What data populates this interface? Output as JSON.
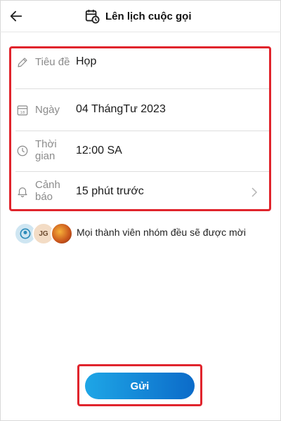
{
  "header": {
    "title": "Lên lịch cuộc gọi"
  },
  "form": {
    "title_row": {
      "label": "Tiêu đề",
      "value": "Họp"
    },
    "date_row": {
      "label": "Ngày",
      "value": "04 ThángTư 2023"
    },
    "time_row": {
      "label_line1": "Thời",
      "label_line2": "gian",
      "value": "12:00 SA"
    },
    "alert_row": {
      "label_line1": "Cảnh",
      "label_line2": "báo",
      "value": "15 phút trước"
    }
  },
  "participants": {
    "avatar_initials": "JG",
    "invite_text": "Mọi thành viên nhóm đều sẽ được mời"
  },
  "send_button": {
    "label": "Gửi"
  },
  "colors": {
    "highlight": "#e0242c",
    "button_start": "#1ea6e6",
    "button_end": "#0c6bc9",
    "muted_text": "#8b8b8b"
  },
  "icons": {
    "back": "arrow-left-icon",
    "calendar_clock": "calendar-clock-icon",
    "pencil": "pencil-icon",
    "calendar": "calendar-icon",
    "clock": "clock-icon",
    "bell": "bell-icon",
    "chevron": "chevron-right-icon"
  }
}
